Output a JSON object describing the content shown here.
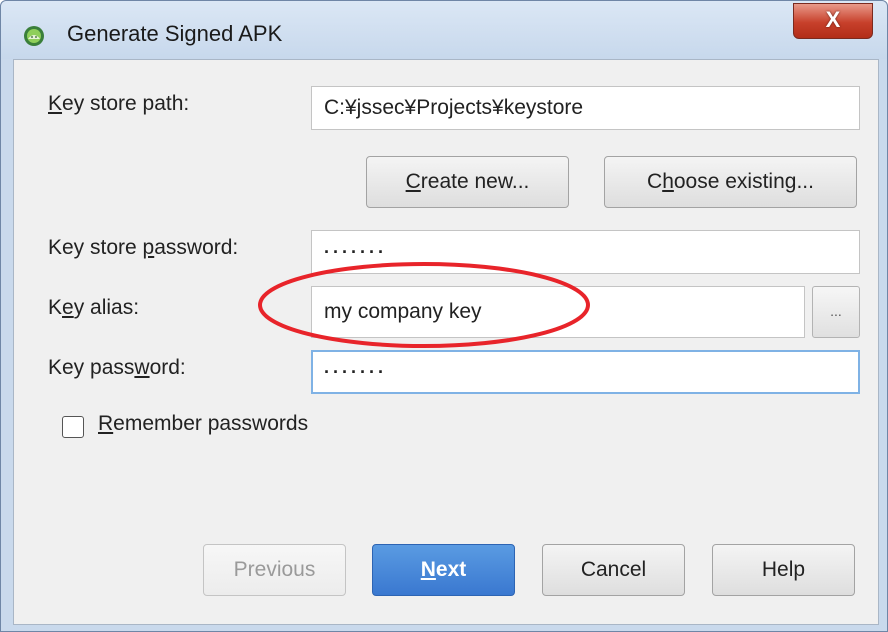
{
  "window": {
    "title": "Generate Signed APK",
    "close_label": "X"
  },
  "form": {
    "key_store_path": {
      "label_prefix": "",
      "label_mnemonic": "K",
      "label_rest": "ey store path:",
      "value": "C:¥jssec¥Projects¥keystore"
    },
    "create_new": {
      "mnemonic": "C",
      "rest": "reate new..."
    },
    "choose_existing": {
      "prefix": "C",
      "mnemonic": "h",
      "rest": "oose existing..."
    },
    "key_store_password": {
      "label_prefix": "Key store ",
      "label_mnemonic": "p",
      "label_rest": "assword:",
      "value": "·······"
    },
    "key_alias": {
      "label_prefix": "K",
      "label_mnemonic": "e",
      "label_rest": "y alias:",
      "value": "my company key",
      "browse_label": "..."
    },
    "key_password": {
      "label_prefix": "Key pass",
      "label_mnemonic": "w",
      "label_rest": "ord:",
      "value": "·······"
    },
    "remember_passwords": {
      "mnemonic": "R",
      "rest": "emember passwords",
      "checked": false
    }
  },
  "footer": {
    "previous_label": "Previous",
    "next_mnemonic": "N",
    "next_rest": "ext",
    "cancel_label": "Cancel",
    "help_label": "Help"
  },
  "colors": {
    "annotation": "#e8242a",
    "primary_button": "#3a78d0",
    "focus_border": "#7fb2e5"
  }
}
